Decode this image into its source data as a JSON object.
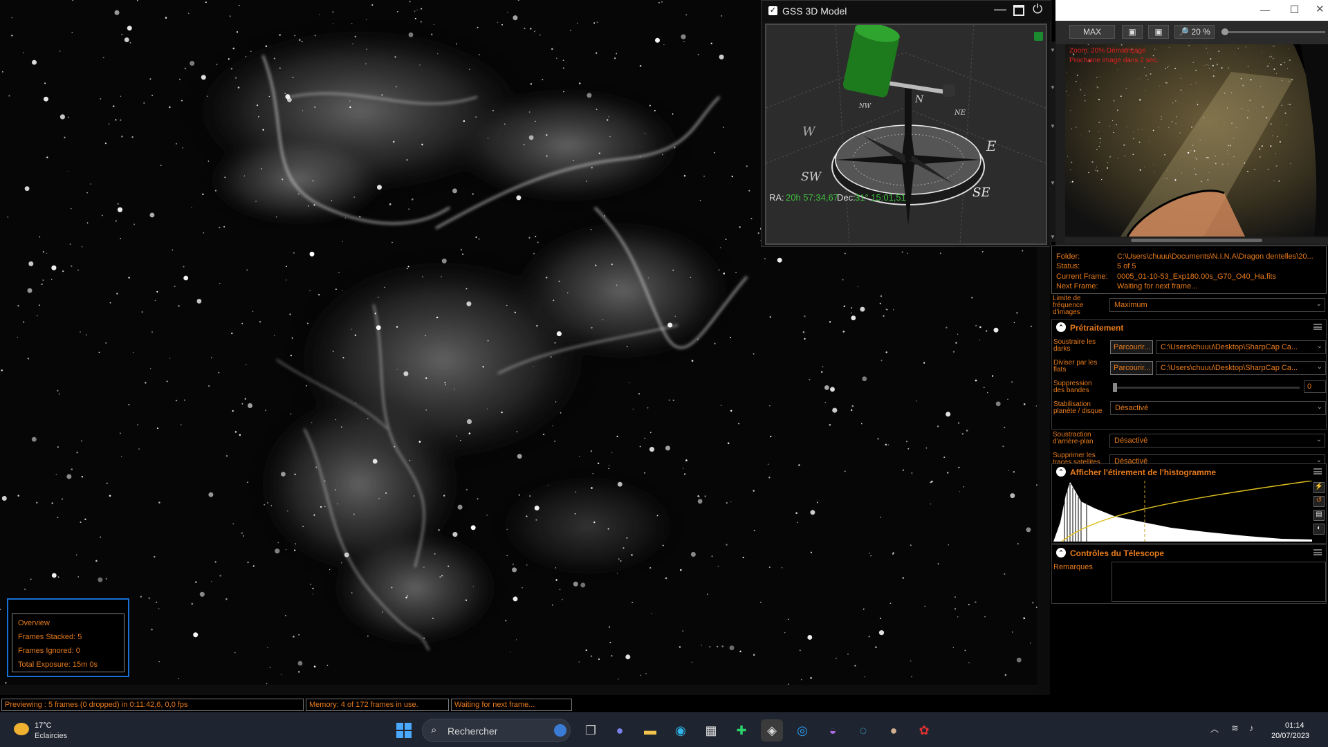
{
  "gss": {
    "title": "GSS 3D Model",
    "ra_label": "RA:",
    "ra_value": "20h 57:34,67",
    "dec_label": "Dec:",
    "dec_value": "31° 15:01,51",
    "compass": [
      "N",
      "NE",
      "E",
      "SE",
      "NW",
      "W",
      "SW"
    ]
  },
  "camera": {
    "toolbar": {
      "max_label": "MAX",
      "zoom_label": "20 %"
    },
    "overlay_line1": "Zoom: 20%   Dématriçage",
    "overlay_line2": "Prochaine image dans 2 sec."
  },
  "info": {
    "folder_label": "Folder:",
    "folder_value": "C:\\Users\\chuuu\\Documents\\N.I.N.A\\Dragon dentelles\\20...",
    "status_label": "Status:",
    "status_value": "5 of 5",
    "current_label": "Current Frame:",
    "current_value": "0005_01-10-53_Exp180.00s_G70_O40_Ha.fits",
    "next_label": "Next Frame:",
    "next_value": "Waiting for next frame..."
  },
  "framerate": {
    "label": "Limite de fréquence d'images",
    "value": "Maximum"
  },
  "pretraitement": {
    "title": "Prétraitement",
    "darks_label": "Soustraire les darks",
    "darks_button": "Parcourir...",
    "darks_path": "C:\\Users\\chuuu\\Desktop\\SharpCap Ca...",
    "flats_label": "Diviser par les flats",
    "flats_button": "Parcourir...",
    "flats_path": "C:\\Users\\chuuu\\Desktop\\SharpCap Ca...",
    "bands_label": "Suppression des bandes",
    "bands_value": "0",
    "stab_label": "Stabilisation planète / disque",
    "stab_value": "Désactivé",
    "bg_label": "Soustraction d'arrière-plan",
    "bg_value": "Désactivé",
    "sat_label": "Supprimer les traces satellites",
    "sat_value": "Désactivé"
  },
  "histogram": {
    "title": "Afficher l'étirement de l'histogramme"
  },
  "telescope": {
    "title": "Contrôles du Télescope",
    "notes_label": "Remarques"
  },
  "overview": {
    "title": "Overview",
    "stacked": "Frames Stacked:  5",
    "ignored": "Frames Ignored:  0",
    "exposure": "Total Exposure:    15m 0s"
  },
  "statusbar": {
    "preview": "Previewing : 5 frames (0 dropped) in 0:11:42,6, 0,0 fps",
    "memory": "Memory: 4 of 172 frames in use.",
    "waiting": "Waiting for next frame..."
  },
  "taskbar": {
    "weather_temp": "17°C",
    "weather_desc": "Eclaircies",
    "search_placeholder": "Rechercher",
    "time": "01:14",
    "date": "20/07/2023"
  },
  "colors": {
    "accent": "#e87b1c",
    "overview_border": "#1a6fd6",
    "ra_value": "#3fbf3f"
  }
}
